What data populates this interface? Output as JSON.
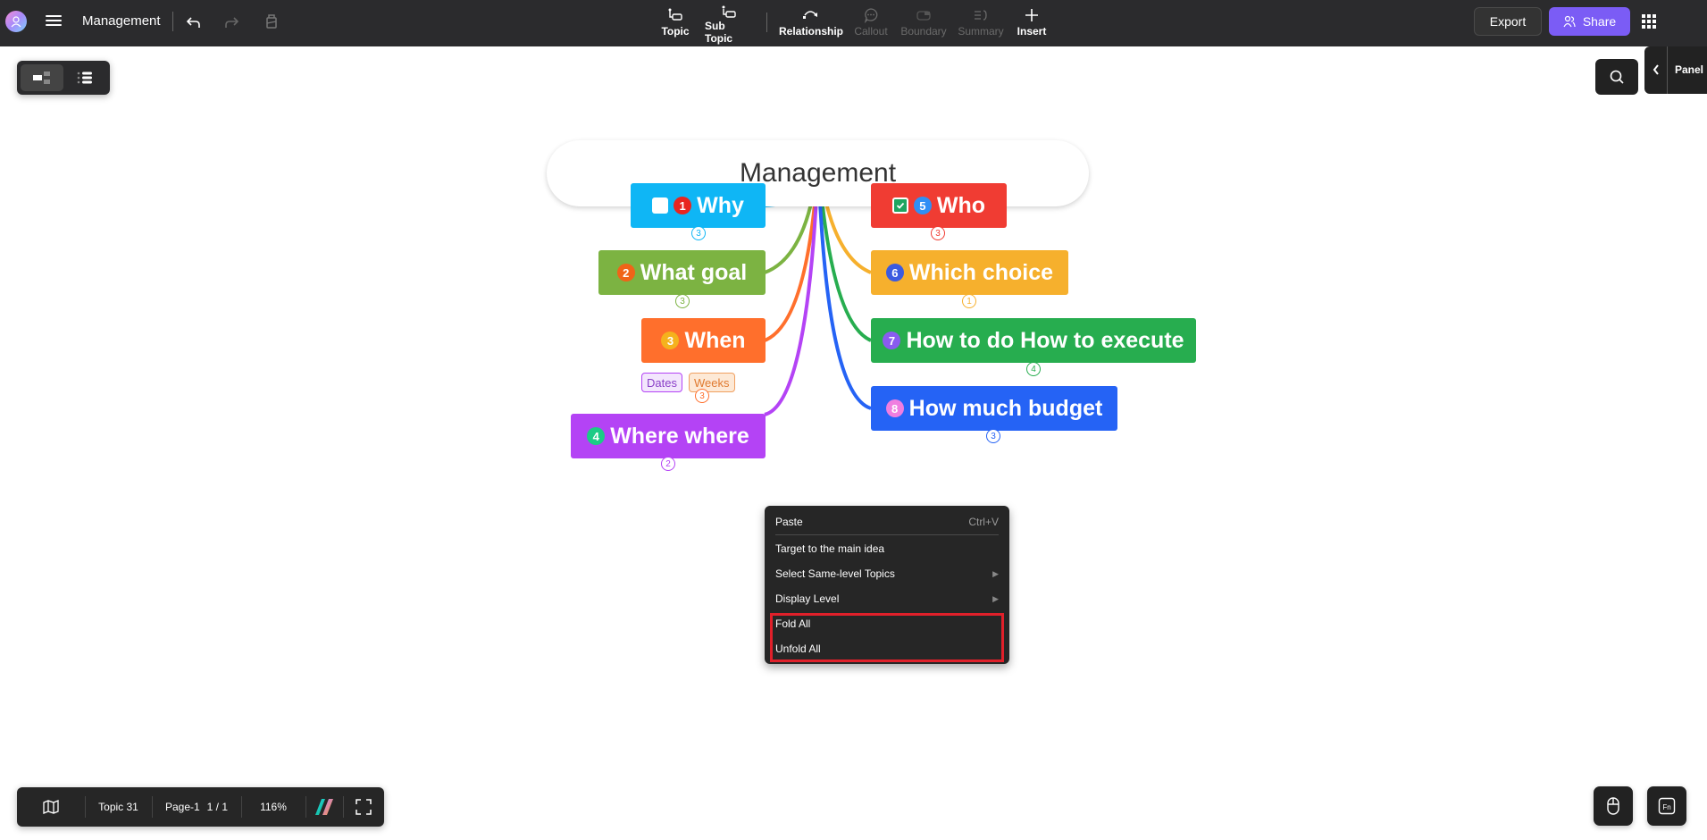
{
  "header": {
    "doc_title": "Management",
    "undo_icon": "undo-icon",
    "redo_icon": "redo-icon",
    "format_painter_icon": "format-painter-icon",
    "tools": [
      {
        "label": "Topic",
        "icon": "topic-icon",
        "enabled": true
      },
      {
        "label": "Sub Topic",
        "icon": "subtopic-icon",
        "enabled": true
      },
      {
        "label": "Relationship",
        "icon": "relationship-icon",
        "enabled": true
      },
      {
        "label": "Callout",
        "icon": "callout-icon",
        "enabled": false
      },
      {
        "label": "Boundary",
        "icon": "boundary-icon",
        "enabled": false
      },
      {
        "label": "Summary",
        "icon": "summary-icon",
        "enabled": false
      },
      {
        "label": "Insert",
        "icon": "plus-icon",
        "enabled": true
      }
    ],
    "export_label": "Export",
    "share_label": "Share",
    "accent_color": "#7b5cf5"
  },
  "side": {
    "panel_label": "Panel"
  },
  "mindmap": {
    "root": "Management",
    "topics": [
      {
        "label": "Why",
        "marker": "1",
        "marker_color": "#e8251f",
        "checkbox": "unchecked",
        "color": "#0fb6f5",
        "children": "3"
      },
      {
        "label": "What goal",
        "marker": "2",
        "marker_color": "#f06418",
        "color": "#7cb342",
        "children": "3"
      },
      {
        "label": "When",
        "marker": "3",
        "marker_color": "#f5b21d",
        "color": "#ff6f2c",
        "children": "3",
        "labels": [
          "Dates",
          "Weeks"
        ]
      },
      {
        "label": "Where where",
        "marker": "4",
        "marker_color": "#1ccb86",
        "color": "#b443f5",
        "children": "2"
      },
      {
        "label": "Who",
        "marker": "5",
        "marker_color": "#2f8ff5",
        "checkbox": "checked",
        "color": "#f03c33",
        "children": "3"
      },
      {
        "label": "Which choice",
        "marker": "6",
        "marker_color": "#3b5be0",
        "color": "#f6b02d",
        "children": "1"
      },
      {
        "label": "How to do How to execute",
        "marker": "7",
        "marker_color": "#8a5bf0",
        "color": "#27ad4f",
        "children": "4"
      },
      {
        "label": "How much budget",
        "marker": "8",
        "marker_color": "#f07ee0",
        "color": "#2563f5",
        "children": "3"
      }
    ]
  },
  "context_menu": {
    "items": [
      {
        "label": "Paste",
        "shortcut": "Ctrl+V"
      },
      {
        "label": "Target to the main idea"
      },
      {
        "label": "Select Same-level Topics",
        "submenu": true
      },
      {
        "label": "Display Level",
        "submenu": true
      },
      {
        "label": "Fold All",
        "highlighted": true
      },
      {
        "label": "Unfold All",
        "highlighted": true
      }
    ],
    "highlight_color": "#e0202a"
  },
  "status": {
    "topic_count": "Topic 31",
    "page_name": "Page-1",
    "page_index": "1 / 1",
    "zoom": "116%"
  }
}
